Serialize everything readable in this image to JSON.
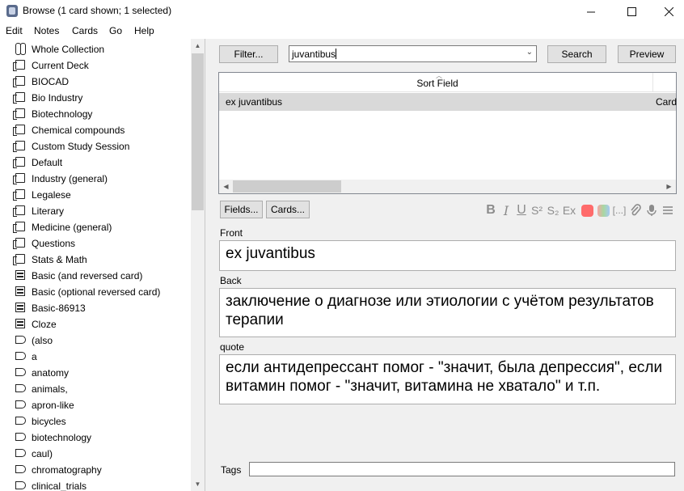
{
  "window": {
    "title": "Browse (1 card shown; 1 selected)",
    "controls": [
      "—",
      "☐",
      "✕"
    ]
  },
  "menu": [
    "Edit",
    "Notes",
    "Cards",
    "Go",
    "Help"
  ],
  "sidebar": {
    "items": [
      {
        "label": "Whole Collection",
        "icon": "collection-icon"
      },
      {
        "label": "Current Deck",
        "icon": "deck-icon"
      },
      {
        "label": "BIOCAD",
        "icon": "deck-icon"
      },
      {
        "label": "Bio Industry",
        "icon": "deck-icon"
      },
      {
        "label": "Biotechnology",
        "icon": "deck-icon"
      },
      {
        "label": "Chemical compounds",
        "icon": "deck-icon"
      },
      {
        "label": "Custom Study Session",
        "icon": "deck-icon"
      },
      {
        "label": "Default",
        "icon": "deck-icon"
      },
      {
        "label": "Industry (general)",
        "icon": "deck-icon"
      },
      {
        "label": "Legalese",
        "icon": "deck-icon"
      },
      {
        "label": "Literary",
        "icon": "deck-icon"
      },
      {
        "label": "Medicine (general)",
        "icon": "deck-icon"
      },
      {
        "label": "Questions",
        "icon": "deck-icon"
      },
      {
        "label": "Stats & Math",
        "icon": "deck-icon"
      },
      {
        "label": "Basic (and reversed card)",
        "icon": "note-type-icon"
      },
      {
        "label": "Basic (optional reversed card)",
        "icon": "note-type-icon"
      },
      {
        "label": "Basic-86913",
        "icon": "note-type-icon"
      },
      {
        "label": "Cloze",
        "icon": "note-type-icon"
      },
      {
        "label": "(also",
        "icon": "tag-icon"
      },
      {
        "label": "a",
        "icon": "tag-icon"
      },
      {
        "label": "anatomy",
        "icon": "tag-icon"
      },
      {
        "label": "animals,",
        "icon": "tag-icon"
      },
      {
        "label": "apron-like",
        "icon": "tag-icon"
      },
      {
        "label": "bicycles",
        "icon": "tag-icon"
      },
      {
        "label": "biotechnology",
        "icon": "tag-icon"
      },
      {
        "label": "caul)",
        "icon": "tag-icon"
      },
      {
        "label": "chromatography",
        "icon": "tag-icon"
      },
      {
        "label": "clinical_trials",
        "icon": "tag-icon"
      }
    ]
  },
  "search": {
    "filter_label": "Filter...",
    "query": "juvantibus",
    "search_label": "Search",
    "preview_label": "Preview"
  },
  "table": {
    "columns": [
      "Sort Field",
      "Card"
    ],
    "rows": [
      {
        "sort_field": "ex juvantibus",
        "card": "Card"
      }
    ]
  },
  "editor": {
    "fields_label": "Fields...",
    "cards_label": "Cards...",
    "toolbar": [
      "B",
      "I",
      "U",
      "S²",
      "S₂",
      "Ex",
      "color",
      "highlight",
      "[...]",
      "attach",
      "record",
      "more"
    ],
    "fields": [
      {
        "name": "Front",
        "value": "ex juvantibus"
      },
      {
        "name": "Back",
        "value": "заключение о диагнозе или этиологии с учётом результатов терапии"
      },
      {
        "name": "quote",
        "value": "если антидепрессант помог - \"значит, была депрессия\", если витамин помог - \"значит, витамина не хватало\" и т.п."
      }
    ],
    "tags_label": "Tags",
    "tags_value": ""
  },
  "colors": {
    "selected_row": "#d9d9d9",
    "button_bg": "#e1e1e1",
    "text_color_swatch": "#ff6b6b",
    "highlight_swatch": "#a8d8a0"
  }
}
